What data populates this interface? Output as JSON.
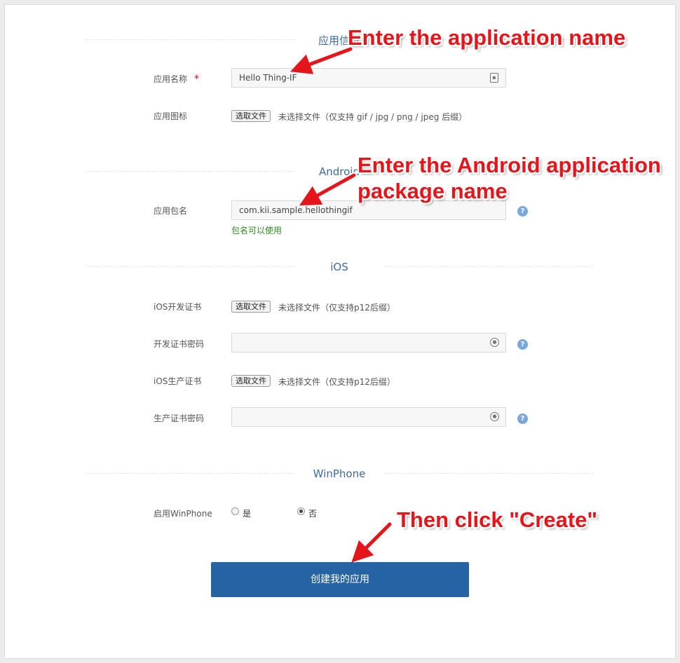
{
  "sections": {
    "app_info": "应用信息",
    "android": "Android",
    "ios": "iOS",
    "winphone": "WinPhone"
  },
  "app_info": {
    "name_label": "应用名称",
    "required_mark": "*",
    "name_value": "Hello Thing-IF",
    "icon_label": "应用图标",
    "choose_file": "选取文件",
    "icon_hint": "未选择文件（仅支持 gif / jpg / png / jpeg 后缀）"
  },
  "android": {
    "package_label": "应用包名",
    "package_value": "com.kii.sample.hellothingif",
    "package_ok": "包名可以使用"
  },
  "ios": {
    "dev_cert_label": "iOS开发证书",
    "dev_cert_button": "选取文件",
    "dev_cert_hint": "未选择文件（仅支持p12后缀）",
    "dev_pass_label": "开发证书密码",
    "prod_cert_label": "iOS生产证书",
    "prod_cert_button": "选取文件",
    "prod_cert_hint": "未选择文件（仅支持p12后缀）",
    "prod_pass_label": "生产证书密码"
  },
  "winphone": {
    "enable_label": "启用WinPhone",
    "yes": "是",
    "no": "否",
    "selected": "否"
  },
  "submit_label": "创建我的应用",
  "help_glyph": "?",
  "annotations": {
    "name": "Enter the application name",
    "package_line1": "Enter the Android application",
    "package_line2": "package name",
    "create": "Then click \"Create\""
  },
  "colors": {
    "accent": "#2563a2",
    "callout": "#e3161b",
    "success": "#2e8b22",
    "help": "#7aa8d8"
  }
}
